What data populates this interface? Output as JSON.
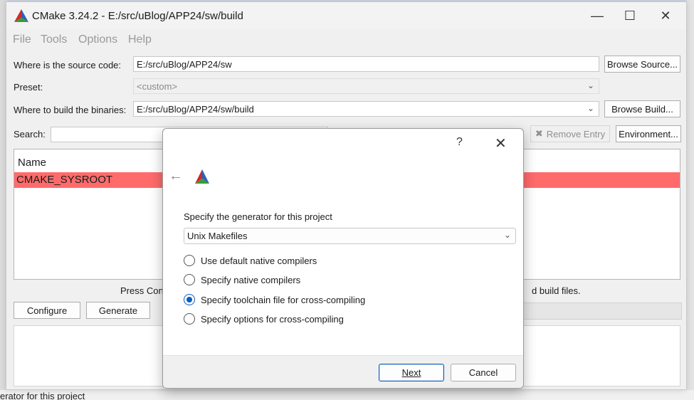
{
  "window": {
    "title": "CMake 3.24.2 - E:/src/uBlog/APP24/sw/build"
  },
  "menu": [
    "File",
    "Tools",
    "Options",
    "Help"
  ],
  "form": {
    "source_label": "Where is the source code:",
    "source_value": "E:/src/uBlog/APP24/sw",
    "browse_source": "Browse Source...",
    "preset_label": "Preset:",
    "preset_value": "<custom>",
    "build_label": "Where to build the binaries:",
    "build_value": "E:/src/uBlog/APP24/sw/build",
    "browse_build": "Browse Build...",
    "search_label": "Search:",
    "remove_entry": "Remove Entry",
    "environment": "Environment..."
  },
  "table": {
    "header": "Name",
    "rows": [
      "CMAKE_SYSROOT"
    ]
  },
  "status": {
    "press_left": "Press Cont",
    "press_right": "d build files."
  },
  "actions": {
    "configure": "Configure",
    "generate": "Generate"
  },
  "background": {
    "bottom_text": "erator for this project"
  },
  "dialog": {
    "help": "?",
    "prompt": "Specify the generator for this project",
    "generator": "Unix Makefiles",
    "options": [
      {
        "label": "Use default native compilers",
        "selected": false
      },
      {
        "label": "Specify native compilers",
        "selected": false
      },
      {
        "label": "Specify toolchain file for cross-compiling",
        "selected": true
      },
      {
        "label": "Specify options for cross-compiling",
        "selected": false
      }
    ],
    "next": "Next",
    "cancel": "Cancel"
  },
  "colors": {
    "highlight_row": "#ff6b6b",
    "accent": "#0a5ebd"
  }
}
